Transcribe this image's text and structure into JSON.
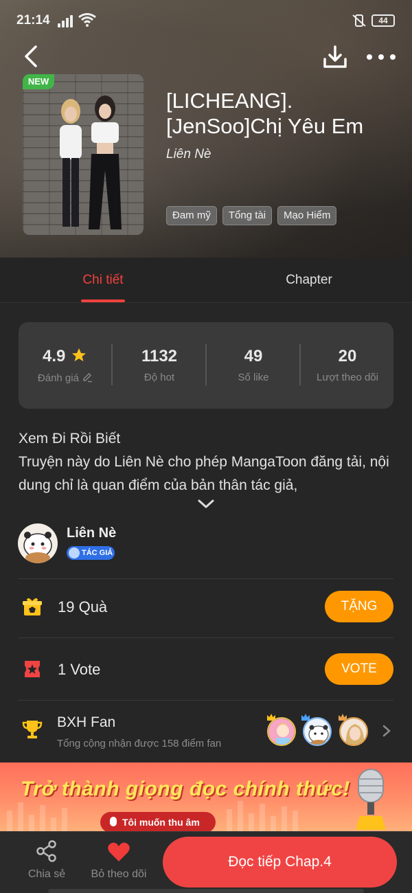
{
  "status_bar": {
    "time": "21:14",
    "battery": "44"
  },
  "header": {
    "badge": "NEW",
    "title": "[LICHEANG].[JenSoo]Chị Yêu Em",
    "author": "Liên Nè",
    "tags": [
      "Đam mỹ",
      "Tổng tài",
      "Mạo Hiểm"
    ],
    "icons": [
      "back-arrow-icon",
      "download-icon",
      "more-icon"
    ]
  },
  "tabs": [
    {
      "label": "Chi tiết",
      "active": true
    },
    {
      "label": "Chapter",
      "active": false
    }
  ],
  "stats": [
    {
      "value": "4.9",
      "label": "Đánh giá"
    },
    {
      "value": "1132",
      "label": "Độ hot"
    },
    {
      "value": "49",
      "label": "Số like"
    },
    {
      "value": "20",
      "label": "Lượt theo dõi"
    }
  ],
  "description": {
    "line1": "Xem Đi Rồi Biết",
    "line2": "Truyện này do Liên Nè cho phép MangaToon đăng tải, nội dung chỉ là quan điểm của bản thân tác giả,"
  },
  "author": {
    "name": "Liên Nè",
    "badge": "TÁC GIẢ"
  },
  "gift_row": {
    "text": "19 Quà",
    "button": "TẶNG"
  },
  "vote_row": {
    "text": "1 Vote",
    "button": "VOTE"
  },
  "fan_row": {
    "title": "BXH Fan",
    "subtitle": "Tổng cộng nhận được 158 điểm fan"
  },
  "banner": {
    "title": "Trở thành giọng đọc chính thức!",
    "button": "Tôi muốn thu âm"
  },
  "bottom_bar": {
    "share": "Chia sẻ",
    "unfollow": "Bỏ theo dõi",
    "read": "Đọc tiếp Chap.4"
  },
  "colors": {
    "accent": "#f2413d",
    "orange": "#ff9800",
    "read_button": "#f04444"
  }
}
